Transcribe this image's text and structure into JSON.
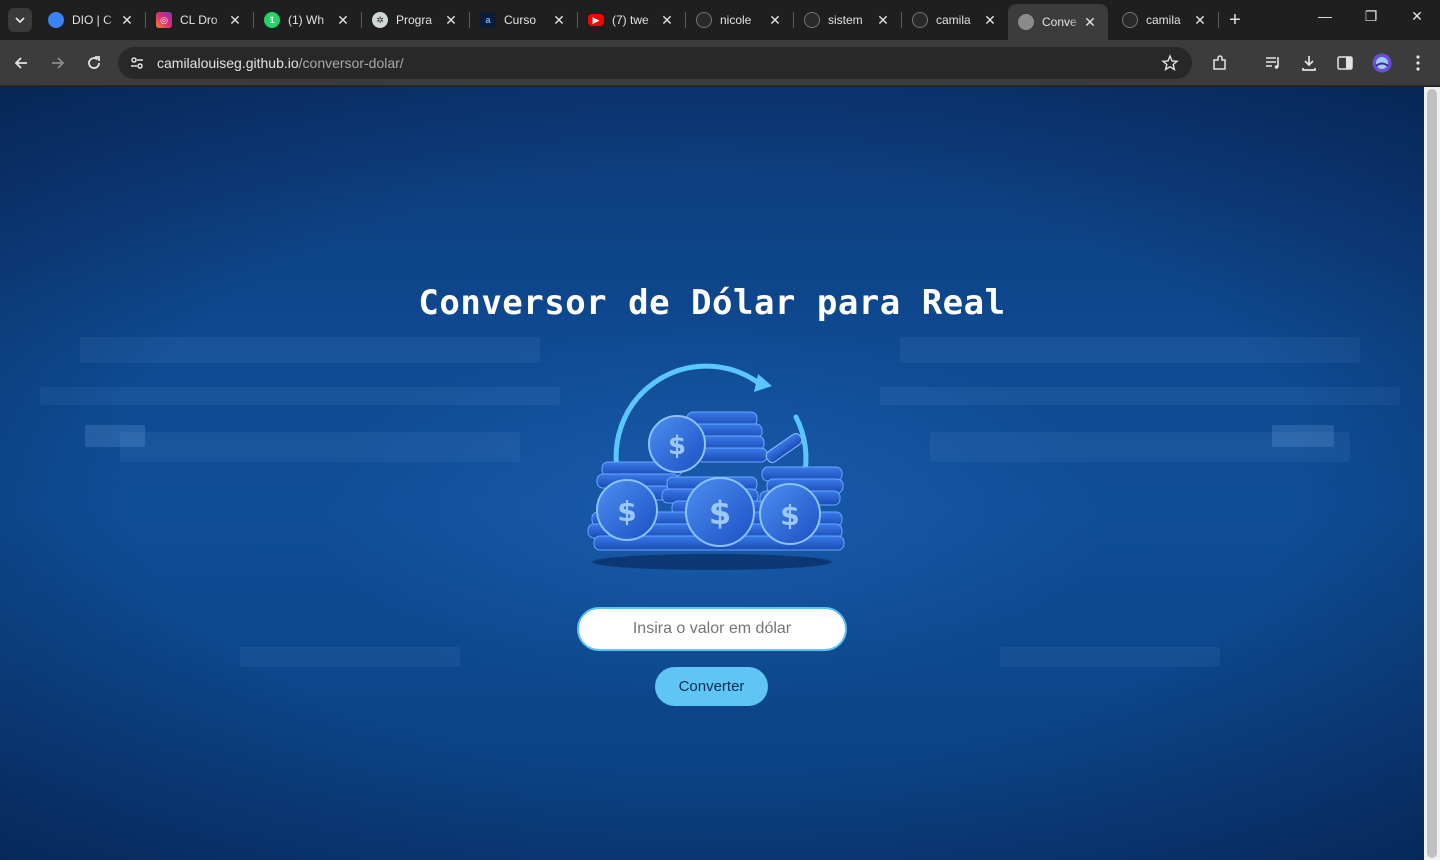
{
  "browser": {
    "tabs": [
      {
        "title": "DIO | C",
        "icon": "dio-icon",
        "color": "#3b82f6"
      },
      {
        "title": "CL Dro",
        "icon": "instagram-icon",
        "color": "#e1306c"
      },
      {
        "title": "(1) Wh",
        "icon": "whatsapp-icon",
        "color": "#25d366"
      },
      {
        "title": "Progra",
        "icon": "chatgpt-icon",
        "color": "#10a37f"
      },
      {
        "title": "Curso",
        "icon": "alura-icon",
        "color": "#1c6fd6"
      },
      {
        "title": "(7) twe",
        "icon": "youtube-icon",
        "color": "#ff0000"
      },
      {
        "title": "nicole",
        "icon": "github-icon",
        "color": "#6e7681"
      },
      {
        "title": "sistem",
        "icon": "github-icon",
        "color": "#6e7681"
      },
      {
        "title": "camila",
        "icon": "github-icon",
        "color": "#6e7681"
      },
      {
        "title": "Conve",
        "icon": "globe-icon",
        "color": "#8a8a8a",
        "active": true
      },
      {
        "title": "camila",
        "icon": "github-icon",
        "color": "#6e7681"
      }
    ],
    "address": {
      "host": "camilalouiseg.github.io",
      "path": "/conversor-dolar/"
    }
  },
  "page": {
    "title": "Conversor de Dólar para Real",
    "input": {
      "placeholder": "Insira o valor em dólar",
      "value": ""
    },
    "button_label": "Converter",
    "colors": {
      "accent": "#5ec5f5",
      "background": "#0f4a92"
    }
  }
}
